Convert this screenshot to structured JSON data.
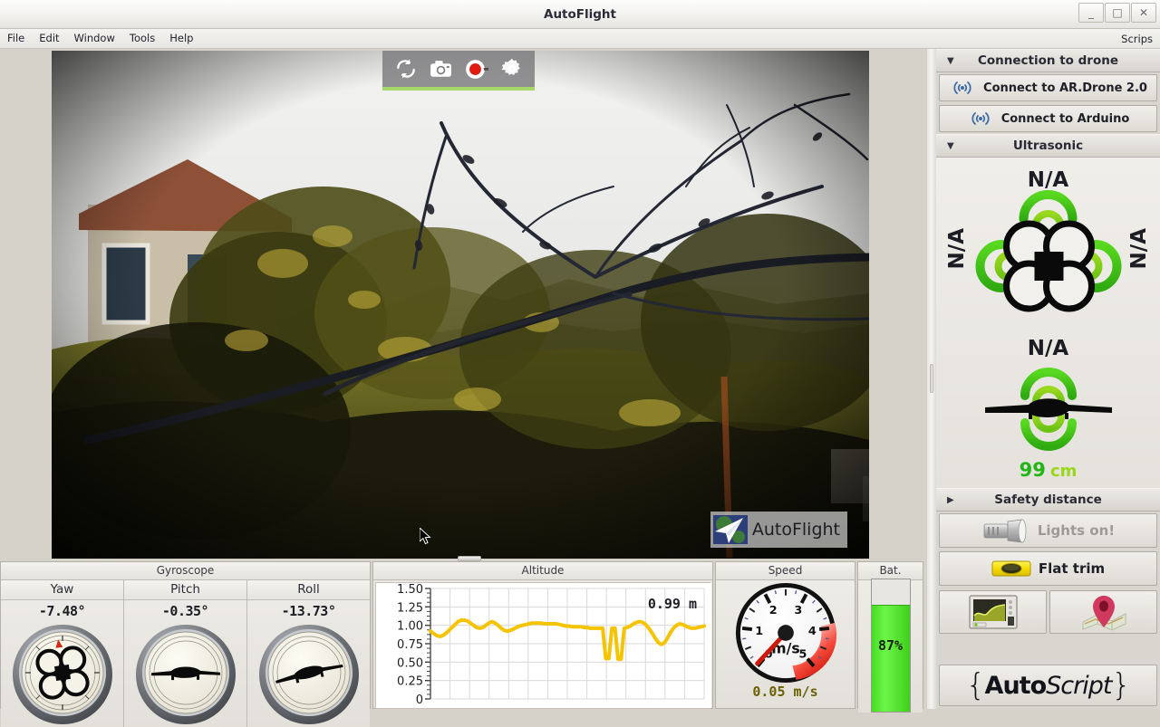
{
  "window": {
    "title": "AutoFlight",
    "minimize_label": "_",
    "maximize_label": "□",
    "close_label": "✕"
  },
  "menubar": {
    "items": [
      "File",
      "Edit",
      "Window",
      "Tools",
      "Help"
    ],
    "right_item": "Scrips"
  },
  "video": {
    "toolbar": [
      {
        "name": "switch-camera-icon",
        "label": "switch-camera"
      },
      {
        "name": "snapshot-icon",
        "label": "snapshot"
      },
      {
        "name": "record-icon",
        "label": "record"
      },
      {
        "name": "settings-gear-icon",
        "label": "settings"
      }
    ],
    "watermark_text": "AutoFlight",
    "accent_color": "#a8d86a"
  },
  "gyroscope": {
    "title": "Gyroscope",
    "axes": [
      {
        "label": "Yaw",
        "value": "-7.48°",
        "numeric": -7.48,
        "gauge": "yaw-compass"
      },
      {
        "label": "Pitch",
        "value": "-0.35°",
        "numeric": -0.35,
        "gauge": "pitch-horizon"
      },
      {
        "label": "Roll",
        "value": "-13.73°",
        "numeric": -13.73,
        "gauge": "roll-horizon"
      }
    ]
  },
  "altitude": {
    "title": "Altitude",
    "readout": "0.99  m",
    "unit": "m",
    "current": 0.99
  },
  "speed": {
    "title": "Speed",
    "readout": "0.05  m/s",
    "dial_unit": "m/s",
    "current": 0.05,
    "max": 5,
    "redline_from": 4,
    "ticks": [
      "0",
      "1",
      "2",
      "3",
      "4",
      "5"
    ]
  },
  "battery": {
    "title": "Bat.",
    "percent_label": "87%",
    "percent": 87,
    "color": "#4fe02a"
  },
  "sidebar": {
    "connection": {
      "header": "Connection to drone",
      "arrow": "▼",
      "buttons": [
        {
          "label": "Connect to AR.Drone 2.0",
          "icon": "wireless-icon"
        },
        {
          "label": "Connect to Arduino",
          "icon": "wireless-icon"
        }
      ]
    },
    "ultrasonic": {
      "header": "Ultrasonic",
      "arrow": "▼",
      "quad": {
        "front": "N/A",
        "left": "N/A",
        "right": "N/A",
        "icon": "quadcopter-top-icon"
      },
      "side": {
        "top": "N/A",
        "bottom_value": "99",
        "bottom_unit": "cm",
        "icon": "drone-side-icon"
      }
    },
    "safety": {
      "header": "Safety distance",
      "arrow": "▶"
    },
    "actions": [
      {
        "label": "Lights on!",
        "icon": "flashlight-icon",
        "disabled": true
      },
      {
        "label": "Flat trim",
        "icon": "spirit-level-icon",
        "disabled": false
      }
    ],
    "icon_buttons": [
      {
        "name": "sensor-graph-icon",
        "label": "sensor graphs"
      },
      {
        "name": "map-pin-icon",
        "label": "map"
      }
    ],
    "autoscript": {
      "brace_open": "{",
      "part1": "Auto",
      "part2": "Script",
      "brace_close": "}"
    }
  },
  "chart_data": {
    "type": "line",
    "title": "Altitude",
    "xlabel": "",
    "ylabel": "m",
    "ylim": [
      0,
      1.5
    ],
    "yticks": [
      0,
      0.25,
      0.5,
      0.75,
      1.0,
      1.25,
      1.5
    ],
    "ytick_labels": [
      "0",
      "0.25",
      "0.50",
      "0.75",
      "1.00",
      "1.25",
      "1.50"
    ],
    "grid": true,
    "legend": "none",
    "line_color": "#f5c400",
    "x": [
      0,
      1,
      2,
      3,
      4,
      5,
      6,
      7,
      8,
      9,
      10,
      11,
      12,
      13,
      14,
      15,
      16,
      17,
      18,
      19,
      20,
      21,
      22,
      23,
      24,
      25,
      26,
      27,
      28,
      29,
      30,
      31,
      32,
      33,
      34,
      35,
      36,
      37,
      38,
      39,
      40,
      41,
      42,
      43,
      44,
      45,
      46,
      47,
      48,
      49,
      50,
      51,
      52,
      53,
      54,
      55,
      56,
      57,
      58,
      59,
      60,
      61,
      62,
      63,
      64,
      65,
      66,
      67,
      68,
      69,
      70,
      71,
      72,
      73,
      74,
      75,
      76,
      77,
      78,
      79,
      80,
      81,
      82,
      83,
      84,
      85,
      86,
      87,
      88,
      89
    ],
    "values": [
      0.92,
      0.89,
      0.86,
      0.85,
      0.86,
      0.89,
      0.93,
      0.97,
      1.01,
      1.05,
      1.07,
      1.07,
      1.06,
      1.03,
      1.0,
      0.97,
      0.96,
      0.97,
      1.0,
      1.03,
      1.05,
      1.03,
      1.0,
      0.96,
      0.93,
      0.92,
      0.93,
      0.95,
      0.97,
      0.99,
      1.0,
      1.01,
      1.02,
      1.03,
      1.03,
      1.03,
      1.03,
      1.02,
      1.02,
      1.02,
      1.02,
      1.02,
      1.01,
      1.0,
      0.99,
      0.99,
      0.98,
      0.98,
      0.98,
      0.98,
      0.97,
      0.97,
      0.96,
      0.96,
      0.96,
      0.96,
      0.96,
      0.55,
      0.55,
      0.96,
      0.96,
      0.54,
      0.54,
      0.96,
      0.97,
      0.99,
      1.02,
      1.04,
      1.05,
      1.04,
      1.01,
      0.96,
      0.9,
      0.83,
      0.77,
      0.74,
      0.76,
      0.82,
      0.9,
      0.96,
      1.0,
      1.02,
      1.01,
      0.99,
      0.97,
      0.96,
      0.96,
      0.97,
      0.98,
      0.99
    ]
  }
}
